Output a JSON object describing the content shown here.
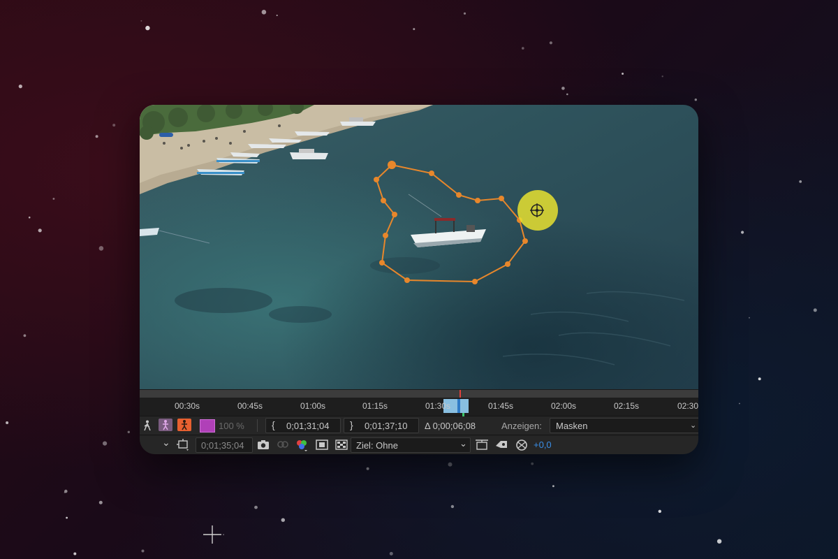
{
  "colors": {
    "mask_path": "#e8872b",
    "cursor": "#e8e030",
    "ruler_text": "#c8c8c8",
    "accent_value": "#3a8fe8",
    "color_swatch": "#b040b8",
    "solo_icon": "#e86030"
  },
  "ruler": {
    "labels": [
      "00:30s",
      "00:45s",
      "01:00s",
      "01:15s",
      "01:30s",
      "01:45s",
      "02:00s",
      "02:15s",
      "02:30"
    ]
  },
  "toolbar_row1": {
    "opacity_value": "100 %",
    "in_point": "0;01;31;04",
    "out_point": "0;01;37;10",
    "duration": "Δ 0;00;06;08",
    "view_label": "Anzeigen:",
    "view_value": "Masken",
    "icons": [
      "walk-icon",
      "puppet-pink-icon",
      "puppet-orange-icon",
      "label-color-swatch"
    ]
  },
  "toolbar_row2": {
    "current_time": "0;01;35;04",
    "target_label": "Ziel: Ohne",
    "exposure_value": "+0,0",
    "icons": [
      "region-icon",
      "camera-icon",
      "link-icon",
      "color-channels-icon",
      "mask-toggle-icon",
      "transparency-grid-icon",
      "chevron-down-icon",
      "frame-reset-icon",
      "eraser-icon",
      "exposure-reset-icon"
    ]
  }
}
